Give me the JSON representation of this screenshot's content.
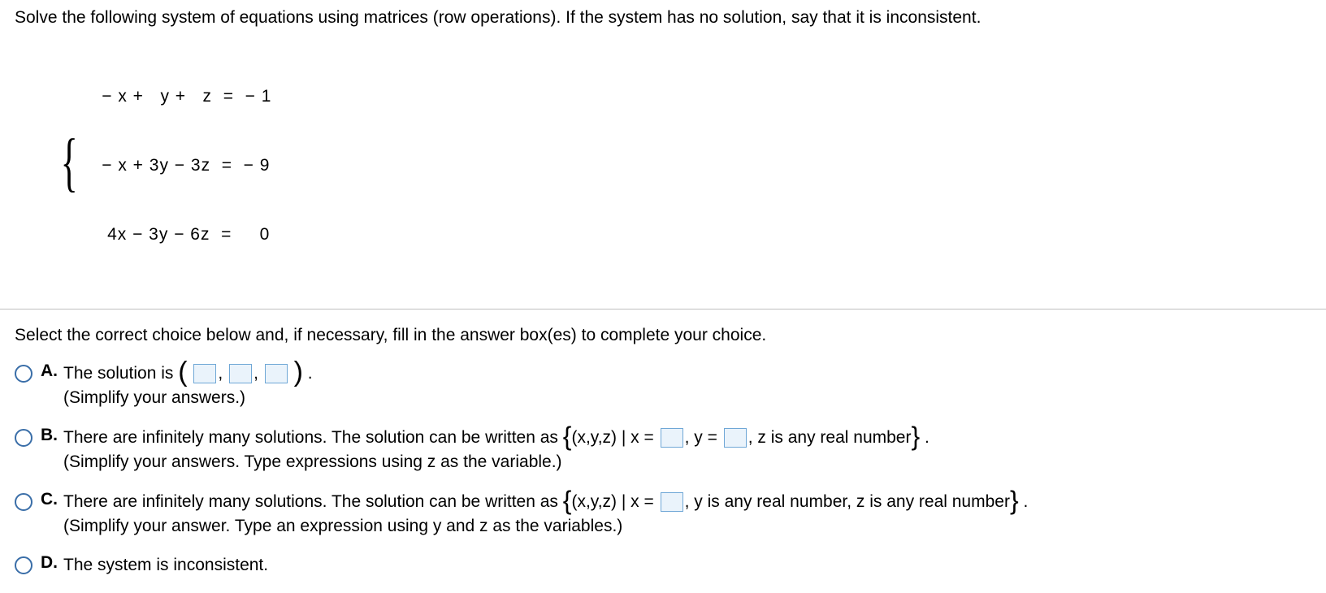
{
  "problem": {
    "prompt": "Solve the following system of equations using matrices (row operations). If the system has no solution, say that it is inconsistent.",
    "eq1": " − x +   y +   z  =  − 1",
    "eq2": " − x + 3y − 3z  =  − 9",
    "eq3": "  4x − 3y − 6z  =     0"
  },
  "instruction": "Select the correct choice below and, if necessary, fill in the answer box(es) to complete your choice.",
  "choices": {
    "A": {
      "letter": "A.",
      "pre": "The solution is ",
      "post": " .",
      "note": "(Simplify your answers.)"
    },
    "B": {
      "letter": "B.",
      "t1": "There are infinitely many solutions. The solution can be written as ",
      "t2": "(x,y,z) | x = ",
      "t3": ", y = ",
      "t4": ", z is any real number",
      "t5": " .",
      "note": "(Simplify your answers. Type expressions using z as the variable.)"
    },
    "C": {
      "letter": "C.",
      "t1": "There are infinitely many solutions. The solution can be written as ",
      "t2": "(x,y,z) | x = ",
      "t3": ", y is any real number, z is any real number",
      "t4": " .",
      "note": "(Simplify your answer. Type an expression using y and z as the variables.)"
    },
    "D": {
      "letter": "D.",
      "text": "The system is inconsistent."
    }
  }
}
